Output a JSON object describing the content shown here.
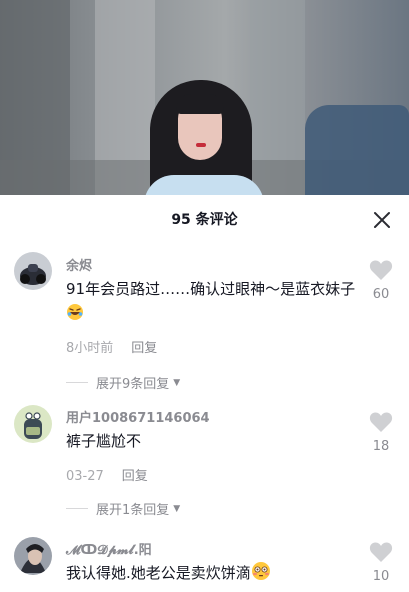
{
  "sheet": {
    "title": "95 条评论"
  },
  "comments": [
    {
      "username": "余烬",
      "text": "91年会员路过……确认过眼神～是蓝衣妹子",
      "emoji": "rolling-laughing-emoji",
      "time": "8小时前",
      "reply_label": "回复",
      "likes": "60",
      "expand_label": "展开9条回复"
    },
    {
      "username": "用户1008671146064",
      "text": "裤子尴尬不",
      "time": "03-27",
      "reply_label": "回复",
      "likes": "18",
      "expand_label": "展开1条回复"
    },
    {
      "username": "𝓜ↀ𝓓𝓹𝓶𝓵.阳",
      "text": "我认得她.她老公是卖炊饼滴",
      "emoji": "flushed-emoji",
      "likes": "10"
    }
  ],
  "icons": {
    "close": "close-icon",
    "like": "heart-icon",
    "expand": "caret-down-icon"
  },
  "colors": {
    "primary_text": "#161823",
    "secondary_text": "#8a8b91",
    "heart": "#cfd0d3"
  }
}
